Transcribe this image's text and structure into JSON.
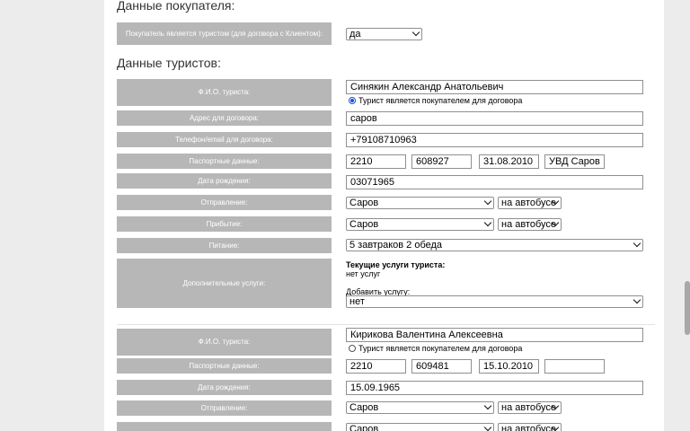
{
  "buyer": {
    "heading": "Данные покупателя:",
    "is_tourist_label": "Покупатель является туристом (для договора с Клиентом):",
    "is_tourist_value": "да"
  },
  "tourists_heading": "Данные туристов:",
  "tourist1": {
    "fio_label": "Ф.И.О. туриста:",
    "fio_value": "Синякин Александр Анатольевич",
    "buyer_radio_label": "Турист является покупателем для договора",
    "address_label": "Адрес для договора:",
    "address_value": "саров",
    "phone_label": "Телефон/email для договора:",
    "phone_value": "+79108710963",
    "passport_label": "Паспортные данные:",
    "passport_series": "2210",
    "passport_number": "608927",
    "passport_date": "31.08.2010",
    "passport_issuer": "УВД Саров",
    "birth_label": "Дата рождения:",
    "birth_value": "03071965",
    "departure_label": "Отправление:",
    "departure_city": "Саров",
    "departure_transport": "на автобусе",
    "arrival_label": "Прибытие:",
    "arrival_city": "Саров",
    "arrival_transport": "на автобусе",
    "meals_label": "Питание:",
    "meals_value": "5 завтраков 2 обеда",
    "services_label": "Дополнительные услуги:",
    "current_services_title": "Текущие услуги туриста:",
    "current_services_value": "нет услуг",
    "add_service_label": "Добавить услугу:",
    "add_service_value": "нет"
  },
  "tourist2": {
    "fio_label": "Ф.И.О. туриста:",
    "fio_value": "Кирикова Валентина Алексеевна",
    "buyer_radio_label": "Турист является покупателем для договора",
    "passport_label": "Паспортные данные:",
    "passport_series": "2210",
    "passport_number": "609481",
    "passport_date": "15.10.2010",
    "passport_issuer": "",
    "birth_label": "Дата рождения:",
    "birth_value": "15.09.1965",
    "departure_label": "Отправление:",
    "departure_city": "Саров",
    "departure_transport": "на автобусе",
    "arrival_city": "Саров",
    "arrival_transport": "на автобусе"
  },
  "colors": {
    "label_bg": "#b7b7b7",
    "page_bg": "#ececec",
    "radio_accent": "#1a4fd6"
  }
}
